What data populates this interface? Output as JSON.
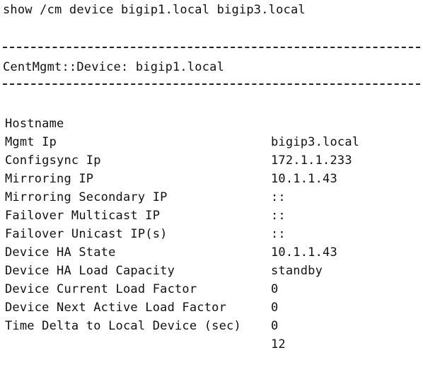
{
  "terminal": {
    "command": "show /cm device bigip1.local bigip3.local",
    "section_title": "CentMgmt::Device: bigip1.local",
    "rows": [
      {
        "key": "Hostname",
        "value": "bigip3.local"
      },
      {
        "key": "Mgmt Ip",
        "value": "172.1.1.233"
      },
      {
        "key": "Configsync Ip",
        "value": "10.1.1.43"
      },
      {
        "key": "Mirroring IP",
        "value": "::"
      },
      {
        "key": "Mirroring Secondary IP",
        "value": "::"
      },
      {
        "key": "Failover Multicast IP",
        "value": "::"
      },
      {
        "key": "Failover Unicast IP(s)",
        "value": "10.1.1.43"
      },
      {
        "key": "Device HA State",
        "value": "standby"
      },
      {
        "key": "Device HA Load Capacity",
        "value": "0"
      },
      {
        "key": "Device Current Load Factor",
        "value": "0"
      },
      {
        "key": "Device Next Active Load Factor",
        "value": "0"
      },
      {
        "key": "Time Delta to Local Device (sec)",
        "value": "12"
      }
    ]
  }
}
